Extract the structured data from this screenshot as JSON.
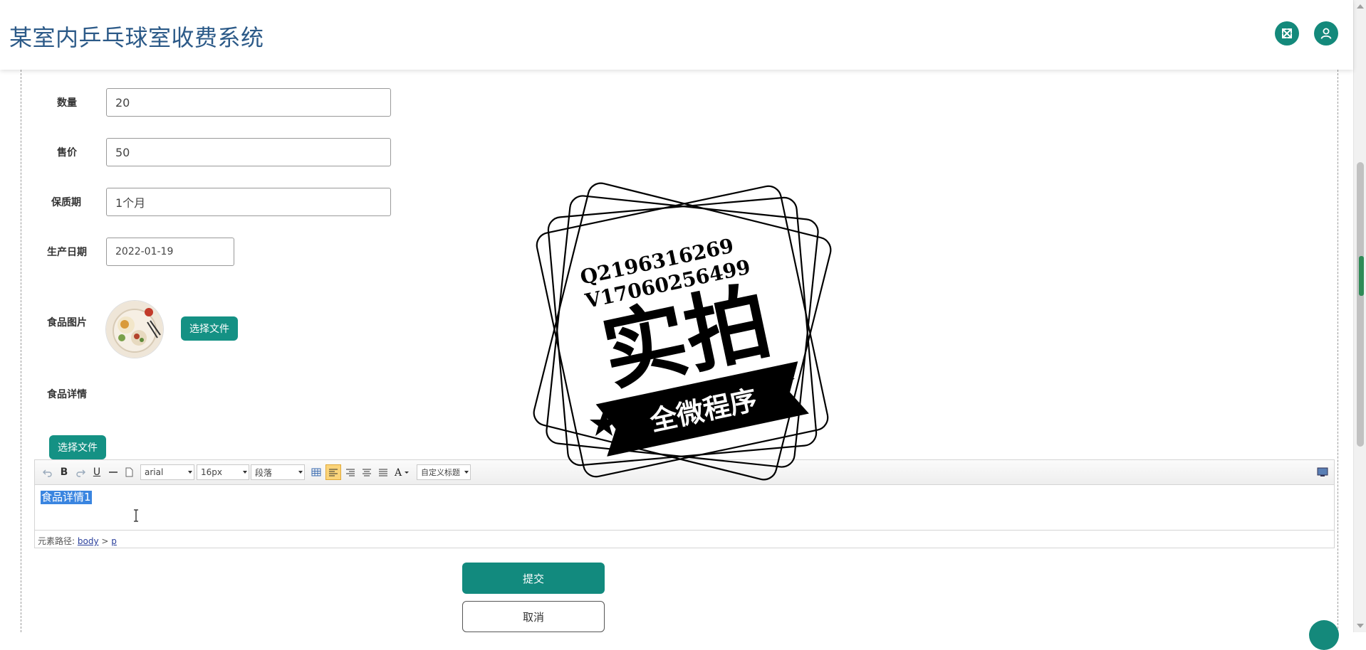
{
  "header": {
    "title": "某室内乒乓球室收费系统"
  },
  "form": {
    "quantity": {
      "label": "数量",
      "value": "20"
    },
    "price": {
      "label": "售价",
      "value": "50"
    },
    "shelf_life": {
      "label": "保质期",
      "value": "1个月"
    },
    "production_date": {
      "label": "生产日期",
      "value": "2022-01-19"
    },
    "food_image": {
      "label": "食品图片",
      "button": "选择文件"
    },
    "food_detail": {
      "label": "食品详情",
      "button": "选择文件"
    }
  },
  "editor": {
    "font_family": "arial",
    "font_size": "16px",
    "paragraph": "段落",
    "custom_title": "自定义标题",
    "content": "食品详情1",
    "path_label": "元素路径:",
    "path_body": "body",
    "path_sep": ">",
    "path_p": "p"
  },
  "actions": {
    "submit": "提交",
    "cancel": "取消"
  },
  "watermark": {
    "line1": "Q2196316269",
    "line2": "V17060256499",
    "main": "实拍",
    "banner": "全微程序"
  },
  "colors": {
    "accent": "#149184",
    "title": "#2c5a88",
    "selection": "#3a85e0"
  }
}
